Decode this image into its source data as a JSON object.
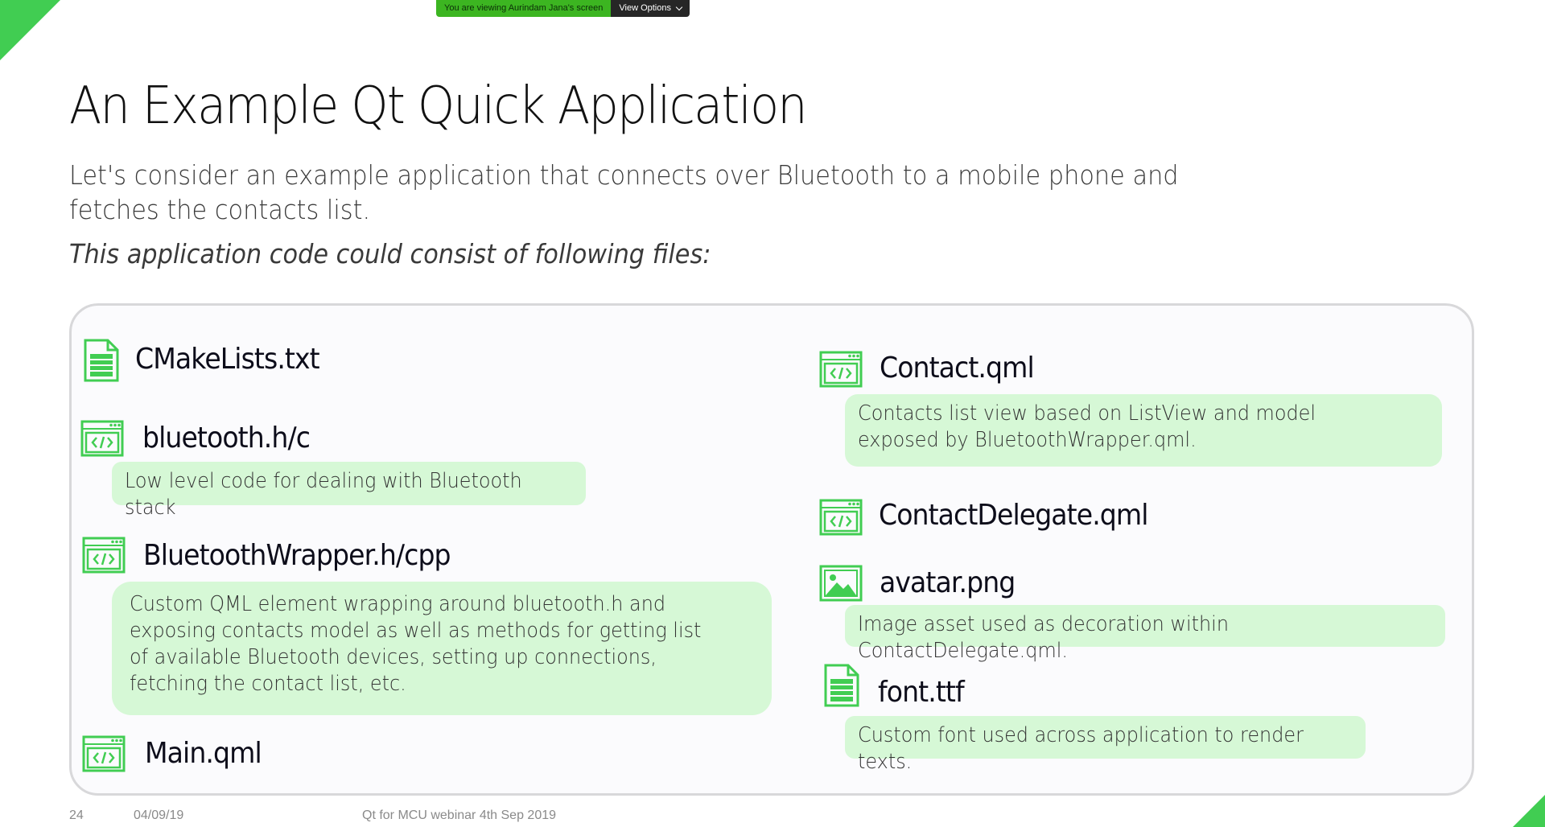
{
  "screen_share": {
    "viewing_text": "You are viewing Aurindam Jana's screen",
    "view_options_label": "View Options"
  },
  "slide": {
    "title": "An Example Qt Quick Application",
    "intro": "Let's consider an example application that connects over Bluetooth to a mobile phone and fetches the contacts list.",
    "subtitle": "This application code could consist of following files:",
    "files": {
      "cmakelists": {
        "name": "CMakeLists.txt",
        "icon": "document-icon"
      },
      "bluetooth": {
        "name": "bluetooth.h/c",
        "icon": "code-icon",
        "description": "Low level code for dealing with Bluetooth stack"
      },
      "wrapper": {
        "name": "BluetoothWrapper.h/cpp",
        "icon": "code-icon",
        "description": "Custom QML element wrapping around bluetooth.h and exposing contacts model as well as methods for getting list of available Bluetooth devices, setting up connections, fetching the contact list, etc."
      },
      "main": {
        "name": "Main.qml",
        "icon": "code-icon"
      },
      "contact": {
        "name": "Contact.qml",
        "icon": "code-icon",
        "description": "Contacts list view based on ListView and model exposed by BluetoothWrapper.qml."
      },
      "delegate": {
        "name": "ContactDelegate.qml",
        "icon": "code-icon"
      },
      "avatar": {
        "name": "avatar.png",
        "icon": "image-icon",
        "description": "Image asset used as decoration within ContactDelegate.qml."
      },
      "font": {
        "name": "font.ttf",
        "icon": "document-icon",
        "description": "Custom font used across application to render texts."
      }
    },
    "footer": {
      "page_number": "24",
      "date": "04/09/19",
      "event": "Qt for MCU webinar 4th Sep 2019"
    },
    "accent_color": "#41cd52",
    "description_bg": "#d6f8d6"
  }
}
